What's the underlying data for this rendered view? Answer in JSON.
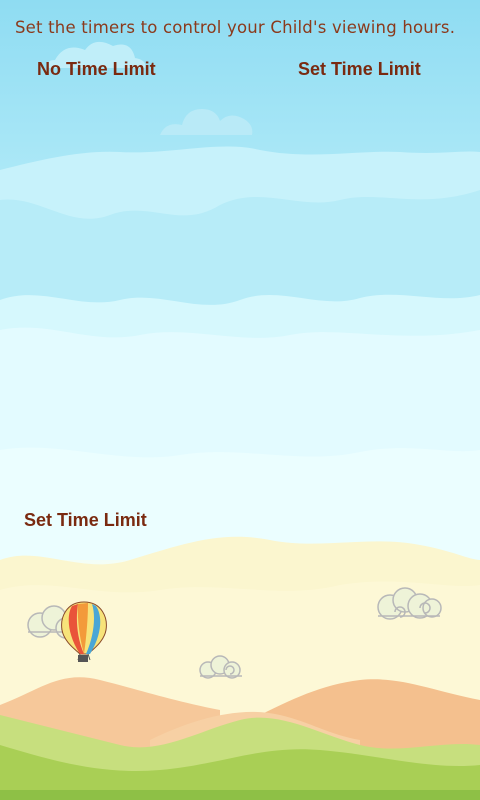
{
  "instruction": "Set the timers to control your Child's viewing hours.",
  "options": {
    "no_time_limit": "No Time Limit",
    "set_time_limit": "Set Time Limit"
  },
  "timer_section": {
    "set_time_limit": "Set Time Limit"
  },
  "colors": {
    "text_primary": "#8b3a1c",
    "button_text": "#7a2a10",
    "sky_top": "#8fdcf2",
    "sky_bottom": "#eaffff",
    "ground_green": "#b9d86b",
    "mountain": "#f6c89a"
  }
}
